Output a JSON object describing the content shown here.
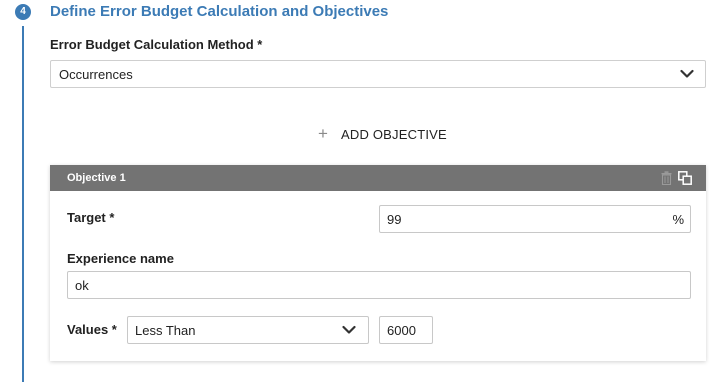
{
  "step": {
    "number": "4",
    "title": "Define Error Budget Calculation and Objectives"
  },
  "method": {
    "label": "Error Budget Calculation Method *",
    "value": "Occurrences"
  },
  "add_objective": {
    "icon": "plus-icon",
    "label": "ADD OBJECTIVE"
  },
  "objective": {
    "title": "Objective 1",
    "target": {
      "label": "Target *",
      "value": "99",
      "unit": "%"
    },
    "experience": {
      "label": "Experience name",
      "value": "ok"
    },
    "values": {
      "label": "Values *",
      "operator": "Less Than",
      "value": "6000"
    }
  },
  "colors": {
    "accent": "#3c7bb5",
    "card_header": "#737373"
  }
}
